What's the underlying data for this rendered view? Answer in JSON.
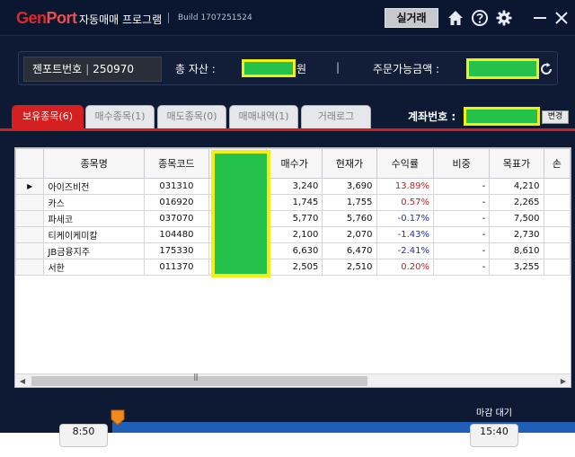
{
  "app": {
    "logo": {
      "gen": "Gen",
      "port": "Port"
    },
    "title": "자동매매 프로그램",
    "build": "Build 1707251524",
    "mode_button": "실거래"
  },
  "toolbar_icons": [
    "home-icon",
    "help-icon",
    "gear-icon",
    "minimize-icon",
    "close-icon"
  ],
  "summary": {
    "account_label": "젠포트번호",
    "account_number": "250970",
    "total_assets_label": "총 자산 :",
    "currency_unit": "원",
    "separator": "|",
    "orderable_label": "주문가능금액 :"
  },
  "tabs": [
    {
      "label": "보유종목(6)",
      "active": true
    },
    {
      "label": "매수종목(1)",
      "active": false
    },
    {
      "label": "매도종목(0)",
      "active": false
    },
    {
      "label": "매매내역(1)",
      "active": false
    },
    {
      "label": "거래로그",
      "active": false
    }
  ],
  "account_field": {
    "label": "계좌번호 :",
    "change_button": "변경"
  },
  "grid": {
    "columns": [
      "종목명",
      "종목코드",
      "",
      "매수가",
      "현재가",
      "수익률",
      "비중",
      "목표가",
      "손"
    ],
    "rows": [
      {
        "name": "아이즈비전",
        "code": "031310",
        "buy": "3,240",
        "cur": "3,690",
        "rate": "13.89%",
        "weight": "-",
        "target": "4,210",
        "sign": "pos",
        "selected": true
      },
      {
        "name": "카스",
        "code": "016920",
        "buy": "1,745",
        "cur": "1,755",
        "rate": "0.57%",
        "weight": "-",
        "target": "2,265",
        "sign": "pos",
        "selected": false
      },
      {
        "name": "파세코",
        "code": "037070",
        "buy": "5,770",
        "cur": "5,760",
        "rate": "-0.17%",
        "weight": "-",
        "target": "7,500",
        "sign": "neg",
        "selected": false
      },
      {
        "name": "티케이케미칼",
        "code": "104480",
        "buy": "2,100",
        "cur": "2,070",
        "rate": "-1.43%",
        "weight": "-",
        "target": "2,730",
        "sign": "neg",
        "selected": false
      },
      {
        "name": "JB금융지주",
        "code": "175330",
        "buy": "6,630",
        "cur": "6,470",
        "rate": "-2.41%",
        "weight": "-",
        "target": "8,610",
        "sign": "neg",
        "selected": false
      },
      {
        "name": "서한",
        "code": "011370",
        "buy": "2,505",
        "cur": "2,510",
        "rate": "0.20%",
        "weight": "-",
        "target": "3,255",
        "sign": "pos",
        "selected": false
      }
    ],
    "row_indicator": "▶",
    "scroll_grip": "|||"
  },
  "timeline": {
    "status_label": "마감 대기",
    "start_time": "8:50",
    "end_time": "15:40"
  },
  "colors": {
    "accent_red": "#d42020",
    "mask_green": "#24c24a",
    "mask_outline": "#f3ef12",
    "positive": "#d11a1a",
    "negative": "#1830c8"
  }
}
